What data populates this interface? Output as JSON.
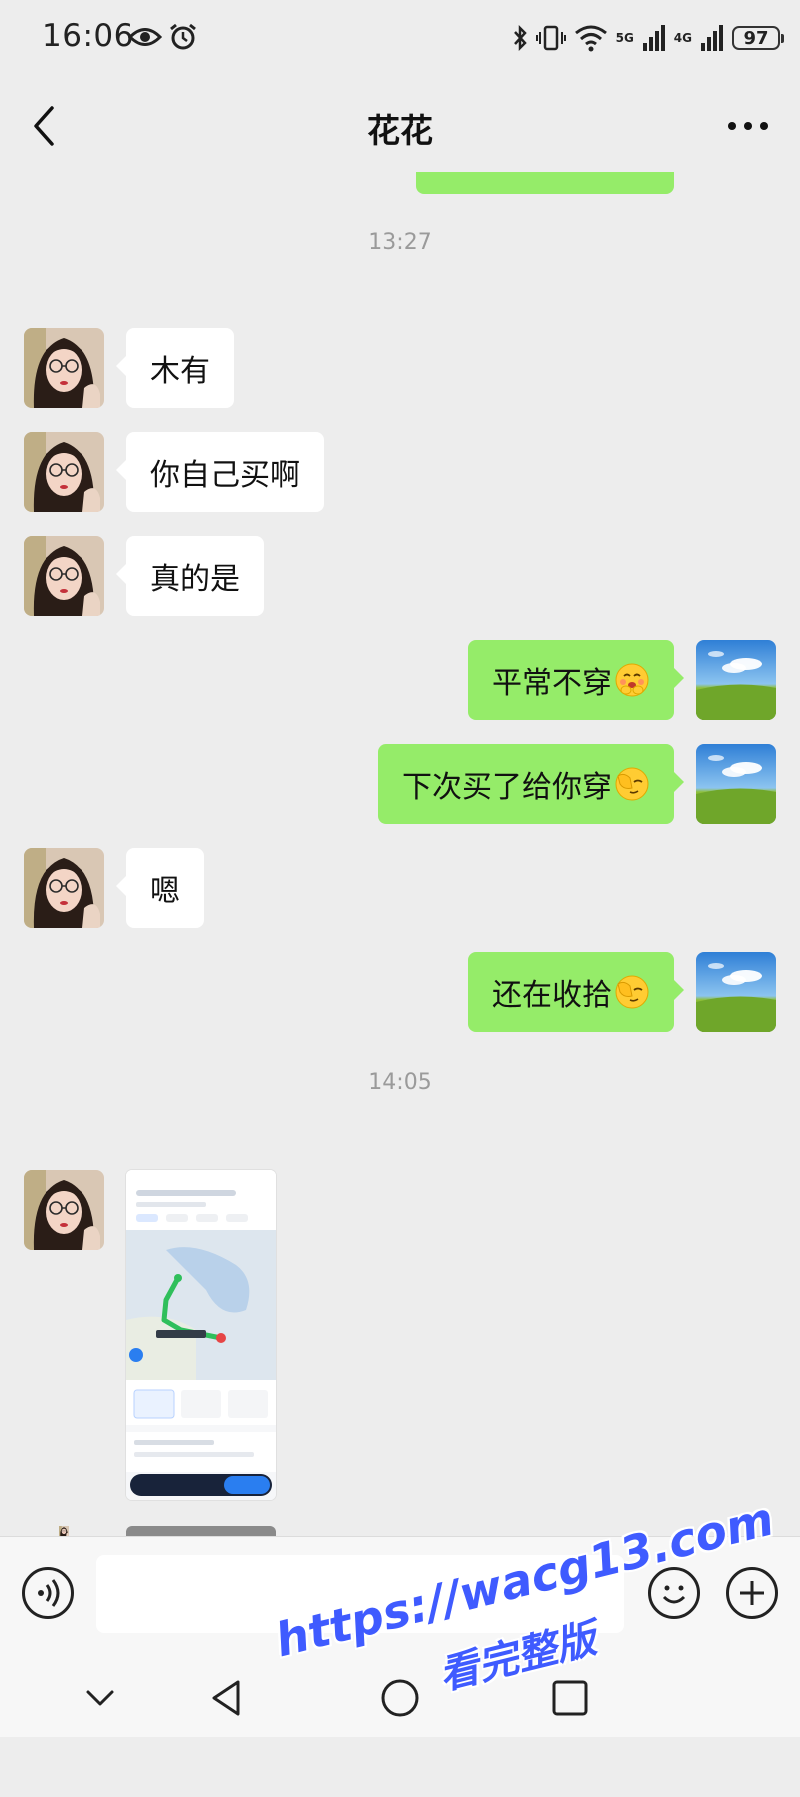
{
  "status_bar": {
    "time": "16:06",
    "network_5g": "5G",
    "network_4g": "4G",
    "battery": "97",
    "icons": [
      "eye-icon",
      "alarm-icon",
      "bluetooth-icon",
      "vibrate-icon",
      "wifi-icon",
      "signal-icon",
      "battery-icon"
    ]
  },
  "header": {
    "title": "花花",
    "back_icon": "chevron-left-icon",
    "more_icon": "more-dots-icon"
  },
  "messages": {
    "time_1": "13:27",
    "time_2": "14:05",
    "msg_1": "木有",
    "msg_2": "你自己买啊",
    "msg_3": "真的是",
    "msg_4": "平常不穿",
    "msg_4_emoji": "blush-hands-emoji",
    "msg_5": "下次买了给你穿",
    "msg_5_emoji": "facepalm-emoji",
    "msg_6": "嗯",
    "msg_7": "还在收拾",
    "msg_7_emoji": "facepalm-emoji",
    "image_1": "map-screenshot"
  },
  "input_bar": {
    "placeholder": "",
    "icons": [
      "voice-icon",
      "emoji-face-icon",
      "plus-icon"
    ]
  },
  "nav_bar": {
    "icons": [
      "collapse-icon",
      "back-triangle-icon",
      "home-circle-icon",
      "recents-square-icon"
    ]
  },
  "watermark": {
    "url": "https://wacg13.com",
    "text": "看完整版"
  },
  "colors": {
    "background": "#ededed",
    "bubble_self": "#95ec69",
    "bubble_other": "#ffffff",
    "watermark": "#3f5bff"
  }
}
